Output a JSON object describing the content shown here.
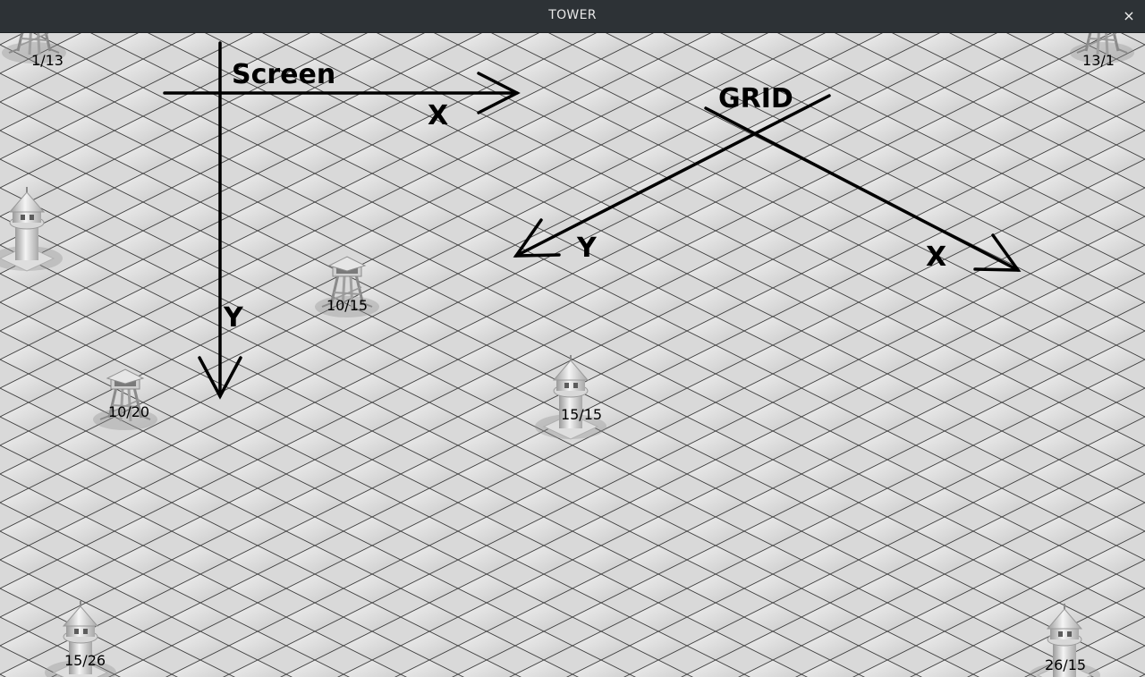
{
  "window": {
    "title": "TOWER",
    "close_glyph": "×",
    "close_icon": "close-icon"
  },
  "annotations": {
    "screen_label": "Screen",
    "screen_x_label": "X",
    "screen_y_label": "Y",
    "grid_label": "GRID",
    "grid_x_label": "X",
    "grid_y_label": "Y"
  },
  "towers": [
    {
      "label": "1/13",
      "kind": "lookout"
    },
    {
      "label": "13/1",
      "kind": "lookout"
    },
    {
      "label": "",
      "kind": "spire"
    },
    {
      "label": "10/15",
      "kind": "lookout"
    },
    {
      "label": "10/20",
      "kind": "lookout"
    },
    {
      "label": "15/15",
      "kind": "spire"
    },
    {
      "label": "15/26",
      "kind": "spire"
    },
    {
      "label": "26/15",
      "kind": "spire"
    }
  ],
  "colors": {
    "tile_light": "#e9e9e9",
    "tile_dark": "#cdcdcd",
    "grid_line": "#3a3a3a",
    "annotation": "#000000",
    "titlebar": "#2d3236"
  }
}
